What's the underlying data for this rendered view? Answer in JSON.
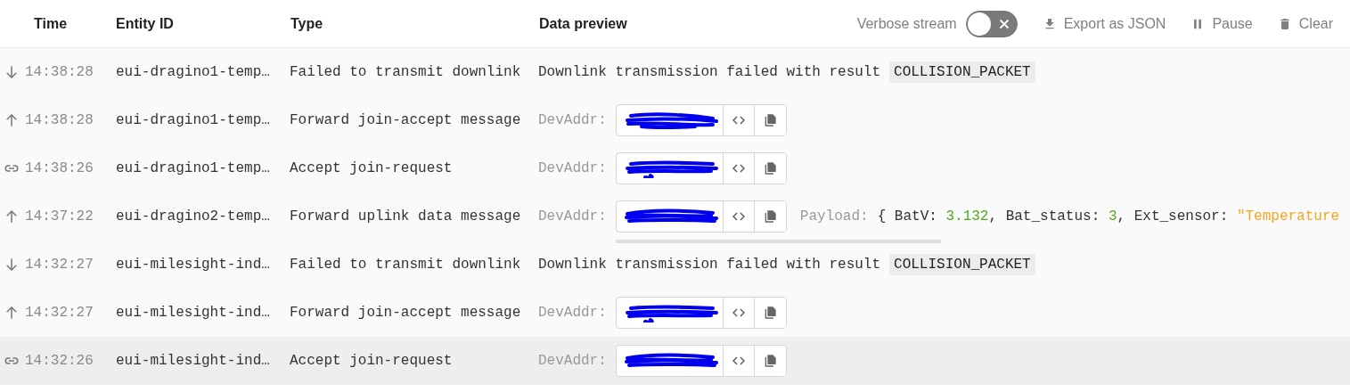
{
  "header": {
    "columns": [
      "Time",
      "Entity ID",
      "Type",
      "Data preview"
    ],
    "verbose_toggle": {
      "label": "Verbose stream",
      "on": false
    },
    "actions": [
      {
        "kind": "export",
        "label": "Export as JSON"
      },
      {
        "kind": "pause",
        "label": "Pause"
      },
      {
        "kind": "clear",
        "label": "Clear"
      }
    ]
  },
  "events": [
    {
      "kind": "down",
      "time": "14:38:28",
      "entity": "eui-dragino1-temp…",
      "type": "Failed to transmit downlink",
      "selected": false,
      "preview": {
        "kind": "error",
        "text": "Downlink transmission failed with result",
        "code": "COLLISION_PACKET"
      }
    },
    {
      "kind": "up",
      "time": "14:38:28",
      "entity": "eui-dragino1-temp…",
      "type": "Forward join-accept message",
      "selected": false,
      "preview": {
        "kind": "devaddr",
        "label": "DevAddr:"
      }
    },
    {
      "kind": "link",
      "time": "14:38:26",
      "entity": "eui-dragino1-temp…",
      "type": "Accept join-request",
      "selected": false,
      "preview": {
        "kind": "devaddr",
        "label": "DevAddr:"
      }
    },
    {
      "kind": "up",
      "time": "14:37:22",
      "entity": "eui-dragino2-temp…",
      "type": "Forward uplink data message",
      "selected": false,
      "preview": {
        "kind": "devaddr",
        "label": "DevAddr:",
        "payload_label": "Payload:",
        "payload": [
          {
            "kind": "punct",
            "text": "{ BatV: "
          },
          {
            "kind": "number",
            "text": "3.132"
          },
          {
            "kind": "punct",
            "text": ", Bat_status: "
          },
          {
            "kind": "number",
            "text": "3"
          },
          {
            "kind": "punct",
            "text": ", Ext_sensor: "
          },
          {
            "kind": "string",
            "text": "\"Temperature"
          }
        ]
      }
    },
    {
      "kind": "down",
      "time": "14:32:27",
      "entity": "eui-milesight-ind…",
      "type": "Failed to transmit downlink",
      "selected": false,
      "preview": {
        "kind": "error",
        "text": "Downlink transmission failed with result",
        "code": "COLLISION_PACKET"
      }
    },
    {
      "kind": "up",
      "time": "14:32:27",
      "entity": "eui-milesight-ind…",
      "type": "Forward join-accept message",
      "selected": false,
      "preview": {
        "kind": "devaddr",
        "label": "DevAddr:"
      }
    },
    {
      "kind": "link",
      "time": "14:32:26",
      "entity": "eui-milesight-ind…",
      "type": "Accept join-request",
      "selected": true,
      "preview": {
        "kind": "devaddr",
        "label": "DevAddr:"
      }
    }
  ]
}
